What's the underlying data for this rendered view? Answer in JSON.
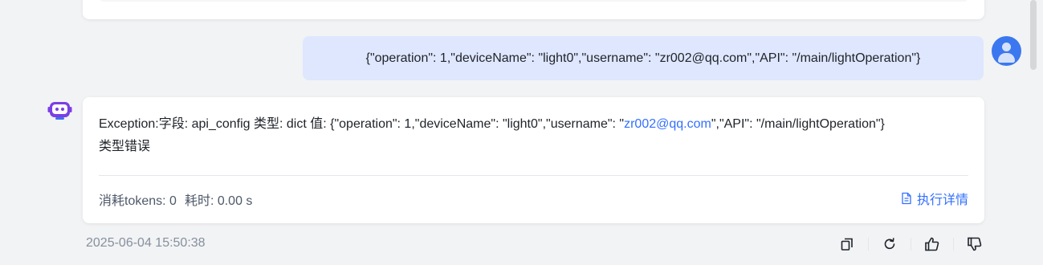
{
  "user_message": {
    "text": "{\"operation\": 1,\"deviceName\": \"light0\",\"username\": \"zr002@qq.com\",\"API\": \"/main/lightOperation\"}"
  },
  "bot_message": {
    "text_before_link": "Exception:字段: api_config 类型: dict 值: {\"operation\": 1,\"deviceName\": \"light0\",\"username\": \"",
    "link_text": "zr002@qq.com",
    "text_after_link": "\",\"API\": \"/main/lightOperation\"}",
    "line2": "类型错误",
    "tokens_label": "消耗tokens: 0",
    "time_label": "耗时: 0.00 s",
    "details_label": "执行详情"
  },
  "footer": {
    "timestamp": "2025-06-04 15:50:38",
    "actions": [
      "copy-icon",
      "regenerate-icon",
      "thumbs-up-icon",
      "thumbs-down-icon"
    ]
  },
  "colors": {
    "accent": "#3370ff",
    "user_bubble": "#dfe7fe",
    "avatar": "#3b78ef",
    "bot_avatar": "#7b3fe4"
  }
}
